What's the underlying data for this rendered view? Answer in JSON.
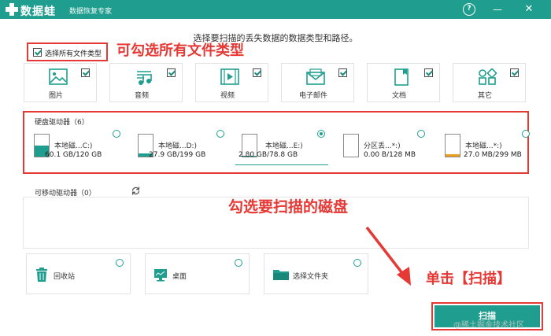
{
  "titlebar": {
    "app_name": "数据蛙",
    "subtitle": "数据恢复专家",
    "help": "?",
    "minimize": "—",
    "close": "✕"
  },
  "instruction": "选择要扫描的丢失数据的数据类型和路径。",
  "select_all": {
    "label": "选择所有文件类型",
    "checked": true
  },
  "annotations": {
    "select_all_hint": "可勾选所有文件类型",
    "disk_hint": "勾选要扫描的磁盘",
    "scan_hint": "单击【扫描】",
    "color": "#e53935"
  },
  "file_types": [
    {
      "label": "图片",
      "icon": "image-icon",
      "checked": true
    },
    {
      "label": "音频",
      "icon": "music-icon",
      "checked": true
    },
    {
      "label": "视频",
      "icon": "video-icon",
      "checked": true
    },
    {
      "label": "电子邮件",
      "icon": "email-icon",
      "checked": true
    },
    {
      "label": "文档",
      "icon": "document-icon",
      "checked": true
    },
    {
      "label": "其它",
      "icon": "other-icon",
      "checked": true
    }
  ],
  "disk_section": {
    "title": "硬盘驱动器（6）",
    "disks": [
      {
        "name": "本地磁...C:)",
        "size": "60.1 GB/120 GB",
        "fill": 0.5,
        "color": "#1f9e8f",
        "selected": false
      },
      {
        "name": "本地磁...D:)",
        "size": "27.9 GB/199 GB",
        "fill": 0.14,
        "color": "#1f9e8f",
        "selected": false
      },
      {
        "name": "本地磁...E:)",
        "size": "2.80 GB/78.8 GB",
        "fill": 0.04,
        "color": "#1f9e8f",
        "selected": true
      },
      {
        "name": "分区丢...*:)",
        "size": "0.00  B/128 MB",
        "fill": 0.0,
        "color": "#e8a020",
        "selected": false
      },
      {
        "name": "本地磁...*:)",
        "size": "27.0 MB/299 MB",
        "fill": 0.09,
        "color": "#e8a020",
        "selected": false
      }
    ]
  },
  "removable_section": {
    "title": "可移动驱动器（0）",
    "refresh_icon": "refresh-icon"
  },
  "locations": [
    {
      "label": "回收站",
      "icon": "recycle-bin-icon"
    },
    {
      "label": "桌面",
      "icon": "desktop-icon"
    },
    {
      "label": "选择文件夹",
      "icon": "folder-icon"
    }
  ],
  "scan_button": "扫描",
  "watermark": "@稀土掘金技术社区",
  "colors": {
    "accent": "#1f9e8f",
    "warning": "#e8a020",
    "annotation": "#e53935"
  }
}
